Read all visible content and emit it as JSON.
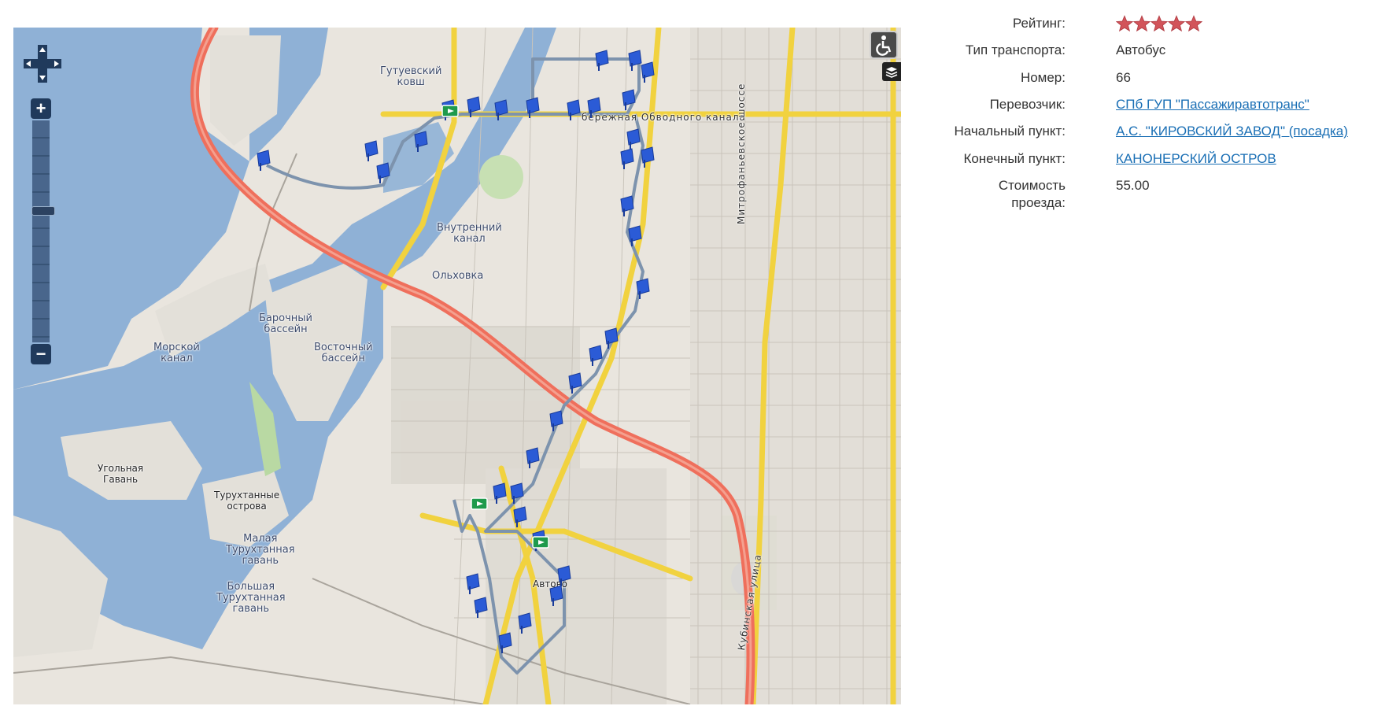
{
  "info": {
    "rating_label": "Рейтинг:",
    "rating_value": 5,
    "rating_max": 5,
    "transport_label": "Тип транспорта:",
    "transport_value": "Автобус",
    "number_label": "Номер:",
    "number_value": "66",
    "carrier_label": "Перевозчик:",
    "carrier_value": "СПб ГУП \"Пассажиравтотранс\"",
    "start_label": "Начальный пункт:",
    "start_value": "А.С. \"КИРОВСКИЙ ЗАВОД\" (посадка)",
    "end_label": "Конечный пункт:",
    "end_value": "КАНОНЕРСКИЙ ОСТРОВ",
    "price_label": "Стоимость\nпроезда:",
    "price_value": "55.00"
  },
  "map": {
    "zoom_in": "+",
    "zoom_out": "−",
    "labels": {
      "gutuevsky": "Гутуевский\nковш",
      "vnutrenny": "Внутренний\nканал",
      "olkhovka": "Ольховка",
      "barochny": "Барочный\nбассейн",
      "morskoy": "Морской\nканал",
      "vostochny": "Восточный\nбассейн",
      "ugolnaya": "Угольная\nГавань",
      "turukhtannye": "Турухтанные\nострова",
      "malaya": "Малая\nТурухтанная\nгавань",
      "bolshaya": "Большая\nТурухтанная\nгавань",
      "avtovo": "Автово",
      "obvodny": "бережная Обводного канала",
      "mitrofanievskoe": "Митрофаньевское шоссе",
      "kubinskaya": "Кубинская улица"
    },
    "colors": {
      "water": "#8fb1d6",
      "land": "#eae6df",
      "highway": "#ef6f5c",
      "major_road": "#f7e15a",
      "route": "#7d93ad",
      "stop": "#2b5bd6",
      "terminal": "#1e9a4c"
    }
  }
}
